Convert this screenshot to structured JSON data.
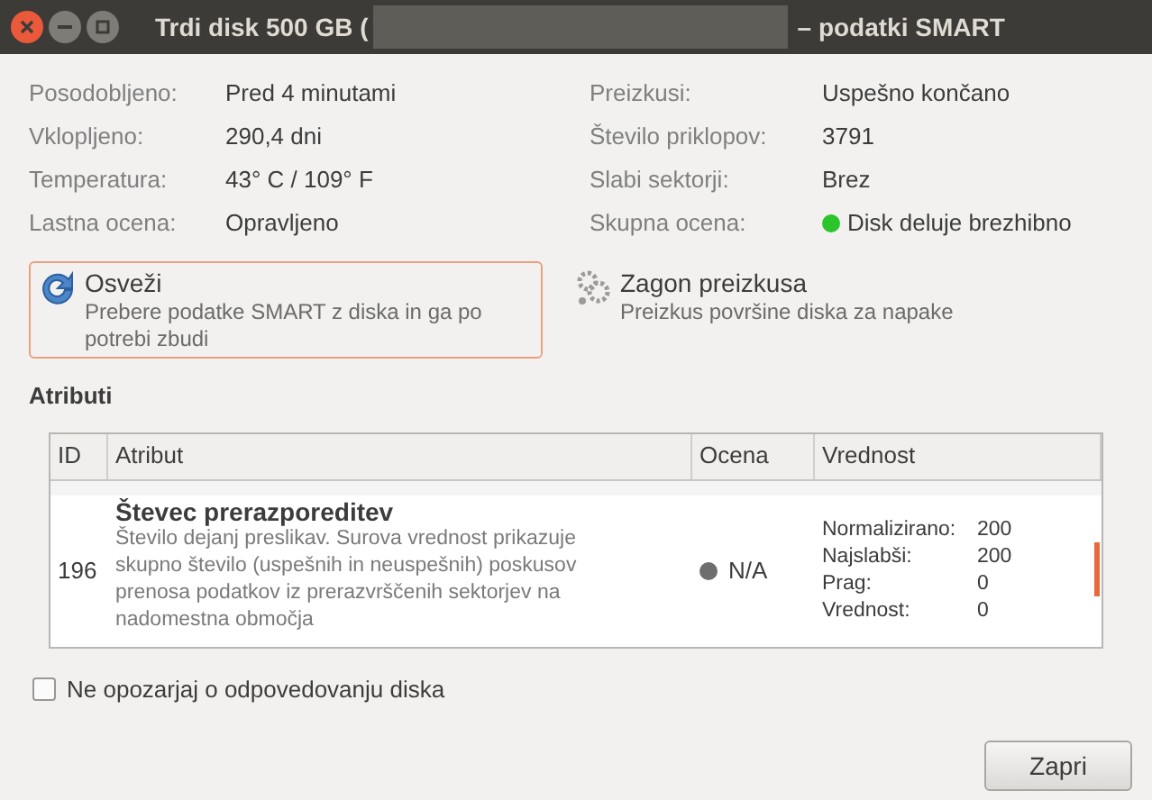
{
  "window": {
    "title_start": "Trdi disk 500 GB (",
    "title_end": "– podatki SMART"
  },
  "info_left": [
    {
      "label": "Posodobljeno:",
      "value": "Pred 4 minutami"
    },
    {
      "label": "Vklopljeno:",
      "value": "290,4 dni"
    },
    {
      "label": "Temperatura:",
      "value": "43° C / 109° F"
    },
    {
      "label": "Lastna ocena:",
      "value": "Opravljeno"
    }
  ],
  "info_right": [
    {
      "label": "Preizkusi:",
      "value": "Uspešno končano"
    },
    {
      "label": "Število priklopov:",
      "value": "3791"
    },
    {
      "label": "Slabi sektorji:",
      "value": "Brez"
    },
    {
      "label": "Skupna ocena:",
      "value": "Disk deluje brezhibno",
      "color": "#2bc42b"
    }
  ],
  "actions": [
    {
      "kind": "refresh",
      "title": "Osveži",
      "description": "Prebere podatke SMART z diska in ga po potrebi zbudi",
      "focused": true
    },
    {
      "kind": "test",
      "title": "Zagon preizkusa",
      "description": "Preizkus površine diska za napake",
      "focused": false
    }
  ],
  "attributes": {
    "heading": "Atributi",
    "columns": [
      "ID",
      "Atribut",
      "Ocena",
      "Vrednost"
    ],
    "rows": [
      {
        "id": "196",
        "name": "Števec prerazporeditev",
        "description": "Število dejanj preslikav. Surova vrednost prikazuje skupno število (uspešnih in neuspešnih) poskusov prenosa podatkov iz prerazvrščenih sektorjev na nadomestna območja",
        "assessment": "N/A",
        "color": "#6e6e6e",
        "values": [
          {
            "label": "Normalizirano:",
            "value": "200"
          },
          {
            "label": "Najslabši:",
            "value": "200"
          },
          {
            "label": "Prag:",
            "value": "0"
          },
          {
            "label": "Vrednost:",
            "value": "0"
          }
        ]
      }
    ]
  },
  "dont_warn": {
    "label": "Ne opozarjaj o odpovedovanju diska",
    "checked": false
  },
  "buttons": [
    "Zapri"
  ]
}
